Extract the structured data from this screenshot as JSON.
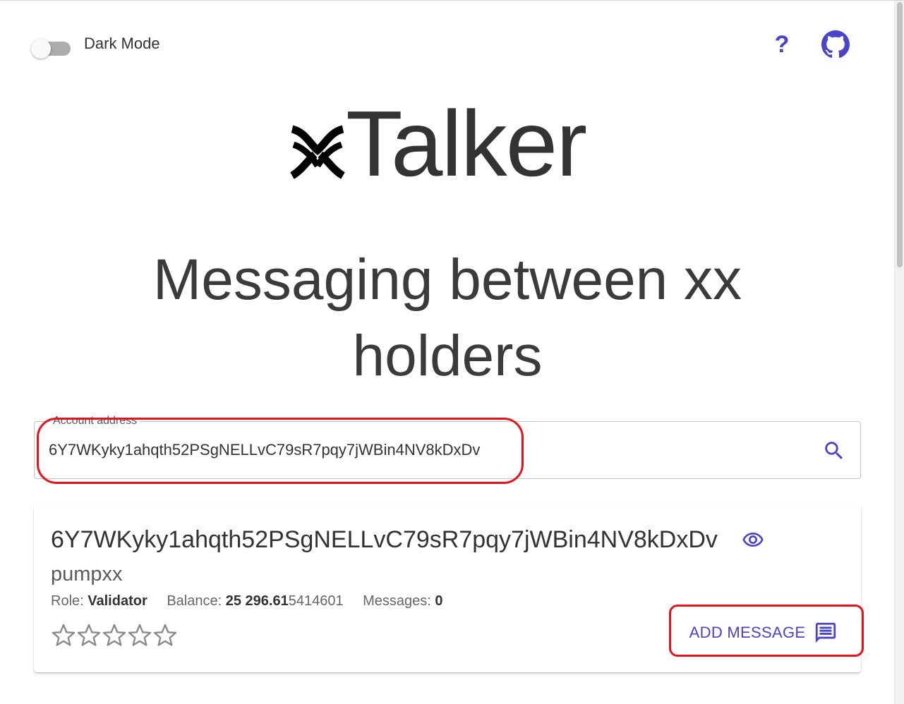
{
  "header": {
    "dark_mode_label": "Dark Mode",
    "dark_mode_on": false,
    "help_icon": "question-mark-icon",
    "github_icon": "github-icon"
  },
  "logo": {
    "mark_icon": "xx-network-logo",
    "text": "Talker"
  },
  "headline": {
    "line1": "Messaging between xx",
    "line2": "holders"
  },
  "search": {
    "label": "Account address",
    "value": "6Y7WKyky1ahqth52PSgNELLvC79sR7pqy7jWBin4NV8kDxDv",
    "icon": "search-icon"
  },
  "account_card": {
    "address": "6Y7WKyky1ahqth52PSgNELLvC79sR7pqy7jWBin4NV8kDxDv",
    "name": "pumpxx",
    "role_label": "Role:",
    "role_value": "Validator",
    "balance_label": "Balance:",
    "balance_bold": "25 296.61",
    "balance_light": "5414601",
    "messages_label": "Messages:",
    "messages_value": "0",
    "rating": 0,
    "rating_max": 5,
    "add_message_label": "ADD MESSAGE",
    "add_message_icon": "chat-message-icon"
  },
  "colors": {
    "accent": "#4a44c9",
    "annotation": "#e8121c",
    "text": "#333333"
  }
}
